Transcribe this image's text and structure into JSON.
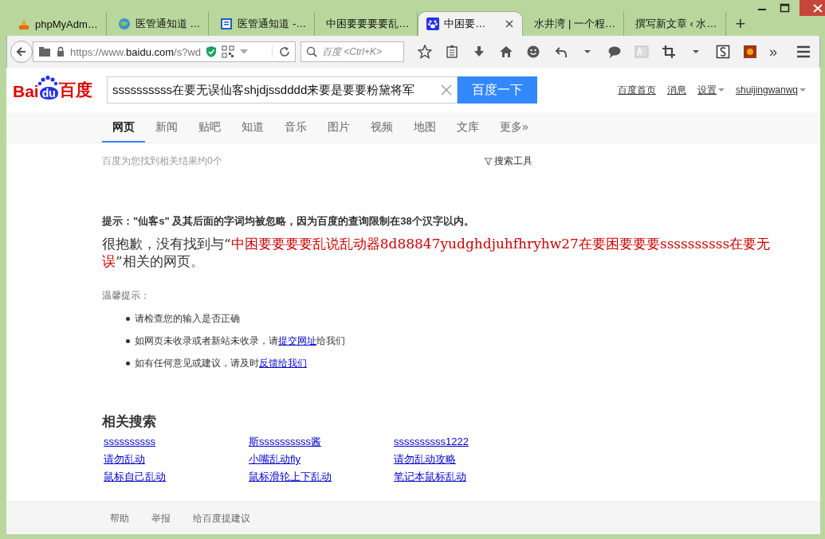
{
  "tabs": [
    {
      "label": "phpMyAdm…",
      "selected": false
    },
    {
      "label": "医管通知道 …",
      "selected": false
    },
    {
      "label": "医管通知道 -…",
      "selected": false
    },
    {
      "label": "中困要要要要乱…",
      "selected": false
    },
    {
      "label": "中困要…",
      "selected": true
    },
    {
      "label": "水井湾 | 一个程…",
      "selected": false
    },
    {
      "label": "撰写新文章 ‹ 水…",
      "selected": false
    }
  ],
  "new_tab": "+",
  "toolbar": {
    "url_scheme": "https://www.",
    "url_host": "baidu.com",
    "url_path": "/s?wd",
    "search_placeholder": "百度 <Ctrl+K>",
    "overflow": "»"
  },
  "header": {
    "logo": {
      "left": "Bai",
      "badge": "du",
      "right": "百度"
    },
    "query": "ssssssssss在要无误仙客shjdjssdddd来要是要要粉黛将军",
    "search_button": "百度一下",
    "links": [
      {
        "label": "百度首页",
        "dropdown": false
      },
      {
        "label": "消息",
        "dropdown": false
      },
      {
        "label": "设置",
        "dropdown": true
      },
      {
        "label": "shuijingwanwq",
        "dropdown": true
      }
    ]
  },
  "nav": [
    {
      "label": "网页",
      "selected": true
    },
    {
      "label": "新闻",
      "selected": false
    },
    {
      "label": "贴吧",
      "selected": false
    },
    {
      "label": "知道",
      "selected": false
    },
    {
      "label": "音乐",
      "selected": false
    },
    {
      "label": "图片",
      "selected": false
    },
    {
      "label": "视频",
      "selected": false
    },
    {
      "label": "地图",
      "selected": false
    },
    {
      "label": "文库",
      "selected": false
    },
    {
      "label": "更多»",
      "selected": false
    }
  ],
  "result_count": "百度为您找到相关结果约0个",
  "search_tools": "搜索工具",
  "notice": "提示：\"仙客s\" 及其后面的字词均被忽略，因为百度的查询限制在38个汉字以内。",
  "no_result": {
    "prefix": "很抱歉，没有找到与“",
    "query": "中困要要要要乱说乱动器8d88847yudghdjuhfhryhw27在要困要要要ssssssssss在要无误",
    "suffix": "”相关的网页。"
  },
  "tips": {
    "title": "温馨提示：",
    "items": [
      {
        "text": "请检查您的输入是否正确"
      },
      {
        "text": "如网页未收录或者新站未收录，请",
        "link": "提交网址",
        "after": "给我们"
      },
      {
        "text": "如有任何意见或建议，请及时",
        "link": "反馈给我们"
      }
    ]
  },
  "related": {
    "title": "相关搜索",
    "rows": [
      [
        "ssssssssss",
        "斯ssssssssss酱",
        "ssssssssss1222"
      ],
      [
        "请勿乱动",
        "小嘴乱动fly",
        "请勿乱动攻略"
      ],
      [
        "鼠标自己乱动",
        "鼠标滑轮上下乱动",
        "笔记本鼠标乱动"
      ]
    ]
  },
  "footer": [
    "帮助",
    "举报",
    "给百度提建议"
  ]
}
